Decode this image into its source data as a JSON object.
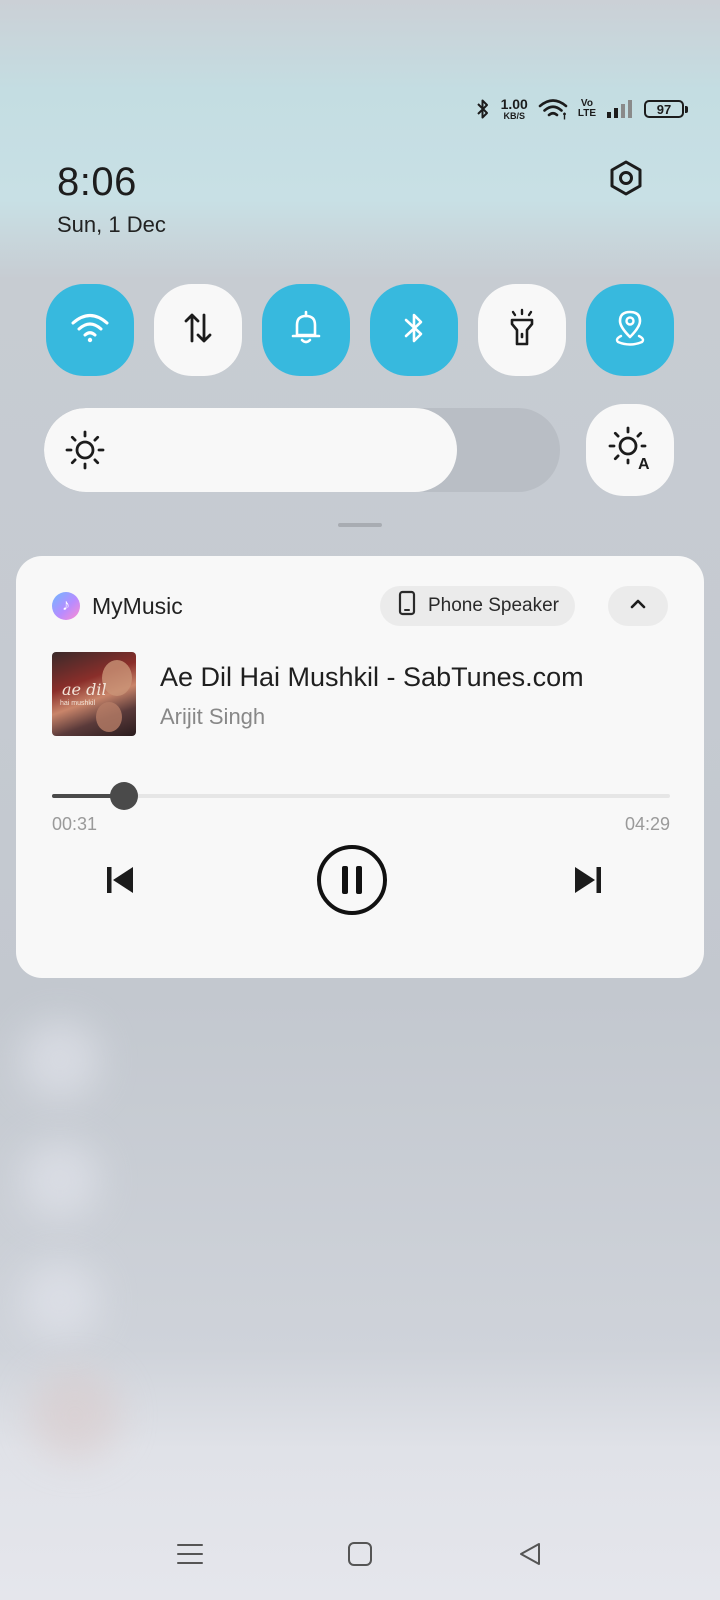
{
  "status_bar": {
    "net_speed_value": "1.00",
    "net_speed_unit": "KB/S",
    "volte_top": "Vo",
    "volte_bottom": "LTE",
    "battery": "97",
    "icons": [
      "bluetooth-icon",
      "wifi-icon",
      "volte-icon",
      "signal-icon",
      "battery-icon"
    ]
  },
  "header": {
    "time": "8:06",
    "date": "Sun, 1 Dec",
    "settings_icon": "settings-hex-icon"
  },
  "quick_tiles": [
    {
      "name": "wifi",
      "icon": "wifi-icon",
      "active": true
    },
    {
      "name": "mobile-data",
      "icon": "data-arrows-icon",
      "active": false
    },
    {
      "name": "sound",
      "icon": "bell-icon",
      "active": true
    },
    {
      "name": "bluetooth",
      "icon": "bluetooth-icon",
      "active": true
    },
    {
      "name": "flashlight",
      "icon": "flashlight-icon",
      "active": false
    },
    {
      "name": "location",
      "icon": "location-icon",
      "active": true
    }
  ],
  "brightness": {
    "level": 0.8,
    "auto_icon": "auto-brightness-icon"
  },
  "media": {
    "app_name": "MyMusic",
    "output_device": "Phone Speaker",
    "title": "Ae Dil Hai Mushkil - SabTunes.com",
    "artist": "Arijit Singh",
    "album_art_text": "ae dil hai mushkil",
    "elapsed": "00:31",
    "total": "04:29",
    "progress": 0.117,
    "state": "playing"
  },
  "colors": {
    "accent": "#37b9de",
    "tile_off": "#f8f8f8",
    "card": "#f8f8f8"
  }
}
